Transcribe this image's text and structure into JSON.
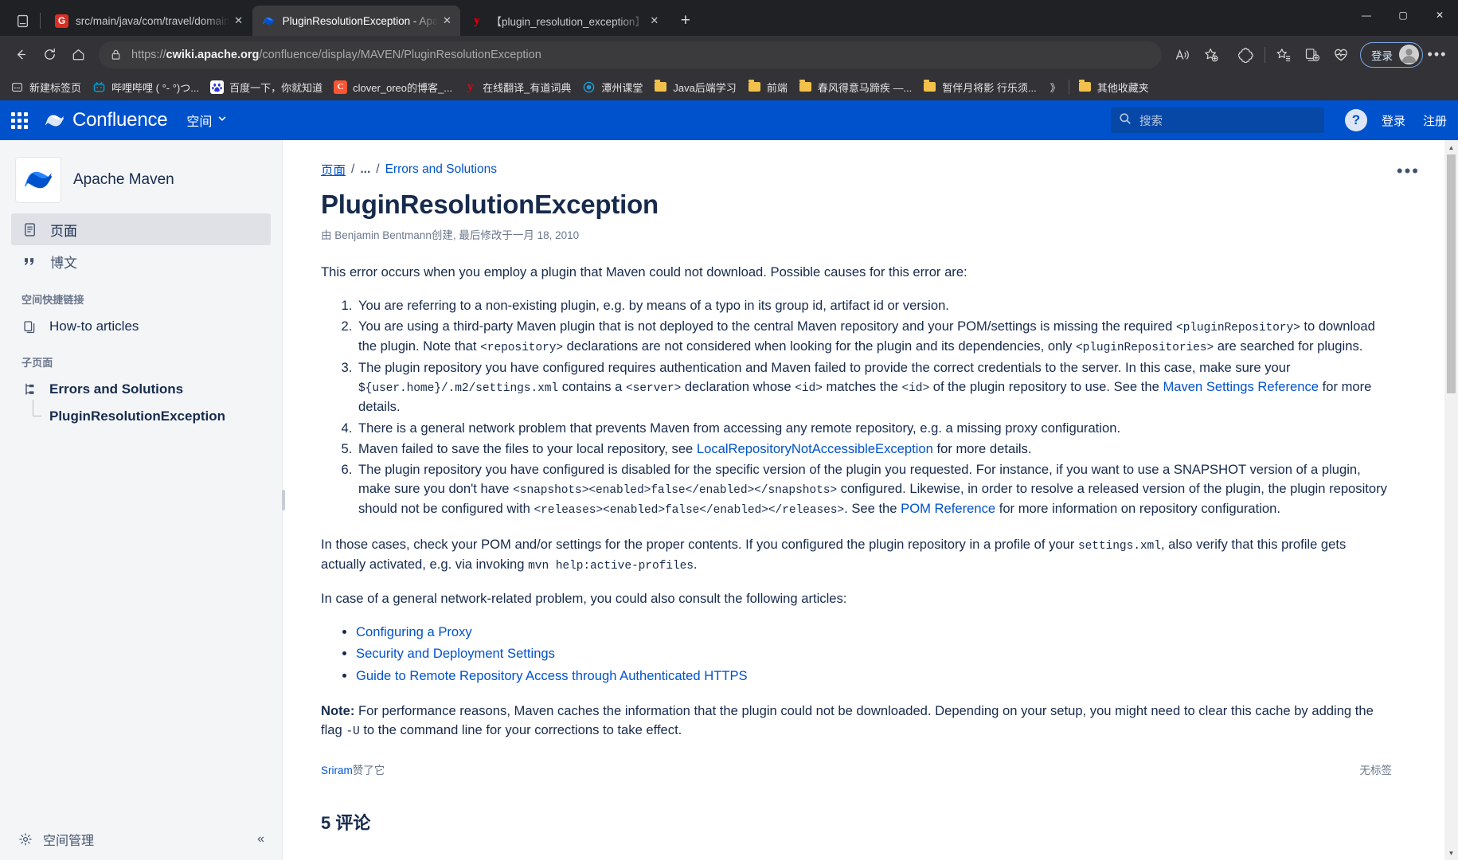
{
  "browser": {
    "tabs": [
      {
        "title": "src/main/java/com/travel/domain",
        "favicon_letter": "G",
        "favicon_color": "#d93025",
        "active": false
      },
      {
        "title": "PluginResolutionException - Apa",
        "favicon_letter": "",
        "favicon_color": "#0052CC",
        "active": true
      },
      {
        "title": "【plugin_resolution_exception】",
        "favicon_letter": "y",
        "favicon_color": "#e60012",
        "active": false
      }
    ],
    "new_tab_label": "+",
    "window_controls": {
      "minimize": "—",
      "maximize": "▢",
      "close": "✕"
    },
    "nav": {
      "back": "←",
      "refresh": "⟳",
      "home": "⌂"
    },
    "url": {
      "scheme": "https://",
      "host": "cwiki.apache.org",
      "path": "/confluence/display/MAVEN/PluginResolutionException"
    },
    "toolbar_right": {
      "signin_label": "登录"
    },
    "bookmarks": [
      {
        "label": "新建标签页",
        "icon": "newtab-icon",
        "color": "#6f7277"
      },
      {
        "label": "哔哩哔哩 ( °- °)つ...",
        "icon": "bilibili-icon",
        "color": "#00a1d6"
      },
      {
        "label": "百度一下，你就知道",
        "icon": "baidu-icon",
        "color": "#2932e1"
      },
      {
        "label": "clover_oreo的博客_...",
        "icon": "csdn-icon",
        "color": "#fc5531"
      },
      {
        "label": "在线翻译_有道词典",
        "icon": "youdao-icon",
        "color": "#e60012"
      },
      {
        "label": "潭州课堂",
        "icon": "tanzhou-icon",
        "color": "#1b9cd8"
      },
      {
        "label": "Java后端学习",
        "icon": "folder-icon",
        "color": "#f2c14b"
      },
      {
        "label": "前端",
        "icon": "folder-icon",
        "color": "#f2c14b"
      },
      {
        "label": "春风得意马蹄疾 —...",
        "icon": "folder-icon",
        "color": "#f2c14b"
      },
      {
        "label": "暂伴月将影 行乐须...",
        "icon": "folder-icon",
        "color": "#f2c14b"
      }
    ],
    "bookmarks_overflow": "》",
    "other_bookmarks": {
      "label": "其他收藏夹",
      "icon": "folder-icon"
    }
  },
  "confluence": {
    "product_name": "Confluence",
    "nav_spaces": "空间",
    "search_placeholder": "搜索",
    "help_label": "?",
    "login": "登录",
    "signup": "注册"
  },
  "sidebar": {
    "space_name": "Apache Maven",
    "items": [
      {
        "label": "页面",
        "icon": "page-icon",
        "selected": true
      },
      {
        "label": "博文",
        "icon": "quote-icon",
        "selected": false
      }
    ],
    "section_shortcuts": "空间快捷链接",
    "shortcuts": [
      {
        "label": "How-to articles",
        "icon": "copy-icon"
      }
    ],
    "section_children": "子页面",
    "children": [
      {
        "label": "Errors and Solutions",
        "icon": "pagetree-icon"
      },
      {
        "label": "PluginResolutionException",
        "icon": ""
      }
    ],
    "footer": {
      "label": "空间管理",
      "icon": "gear-icon",
      "collapse": "«"
    }
  },
  "page": {
    "breadcrumb": {
      "root": "页面",
      "sep": "/",
      "ellipsis": "...",
      "parent": "Errors and Solutions"
    },
    "title": "PluginResolutionException",
    "byline": "由 Benjamin Bentmann创建, 最后修改于一月 18, 2010",
    "more_actions": "•••",
    "intro": "This error occurs when you employ a plugin that Maven could not download. Possible causes for this error are:",
    "causes": [
      {
        "parts": [
          {
            "t": "You are referring to a non-existing plugin, e.g. by means of a typo in its group id, artifact id or version.",
            "k": "text"
          }
        ]
      },
      {
        "parts": [
          {
            "t": "You are using a third-party Maven plugin that is not deployed to the central Maven repository and your POM/settings is missing the required ",
            "k": "text"
          },
          {
            "t": "<pluginRepository>",
            "k": "code"
          },
          {
            "t": " to download the plugin. Note that ",
            "k": "text"
          },
          {
            "t": "<repository>",
            "k": "code"
          },
          {
            "t": " declarations are not considered when looking for the plugin and its dependencies, only ",
            "k": "text"
          },
          {
            "t": "<pluginRepositories>",
            "k": "code"
          },
          {
            "t": " are searched for plugins.",
            "k": "text"
          }
        ]
      },
      {
        "parts": [
          {
            "t": "The plugin repository you have configured requires authentication and Maven failed to provide the correct credentials to the server. In this case, make sure your ",
            "k": "text"
          },
          {
            "t": "${user.home}/.m2/settings.xml",
            "k": "code"
          },
          {
            "t": " contains a ",
            "k": "text"
          },
          {
            "t": "<server>",
            "k": "code"
          },
          {
            "t": " declaration whose ",
            "k": "text"
          },
          {
            "t": "<id>",
            "k": "code"
          },
          {
            "t": " matches the ",
            "k": "text"
          },
          {
            "t": "<id>",
            "k": "code"
          },
          {
            "t": " of the plugin repository to use. See the ",
            "k": "text"
          },
          {
            "t": "Maven Settings Reference",
            "k": "link"
          },
          {
            "t": " for more details.",
            "k": "text"
          }
        ]
      },
      {
        "parts": [
          {
            "t": "There is a general network problem that prevents Maven from accessing any remote repository, e.g. a missing proxy configuration.",
            "k": "text"
          }
        ]
      },
      {
        "parts": [
          {
            "t": "Maven failed to save the files to your local repository, see ",
            "k": "text"
          },
          {
            "t": "LocalRepositoryNotAccessibleException",
            "k": "link"
          },
          {
            "t": " for more details.",
            "k": "text"
          }
        ]
      },
      {
        "parts": [
          {
            "t": "The plugin repository you have configured is disabled for the specific version of the plugin you requested. For instance, if you want to use a SNAPSHOT version of a plugin, make sure you don't have ",
            "k": "text"
          },
          {
            "t": "<snapshots><enabled>false</enabled></snapshots>",
            "k": "code"
          },
          {
            "t": " configured. Likewise, in order to resolve a released version of the plugin, the plugin repository should not be configured with ",
            "k": "text"
          },
          {
            "t": "<releases><enabled>false</enabled></releases>",
            "k": "code"
          },
          {
            "t": ". See the ",
            "k": "text"
          },
          {
            "t": "POM Reference",
            "k": "link"
          },
          {
            "t": " for more information on repository configuration.",
            "k": "text"
          }
        ]
      }
    ],
    "para2": {
      "parts": [
        {
          "t": "In those cases, check your POM and/or settings for the proper contents. If you configured the plugin repository in a profile of your ",
          "k": "text"
        },
        {
          "t": "settings.xml",
          "k": "code"
        },
        {
          "t": ", also verify that this profile gets actually activated, e.g. via invoking ",
          "k": "text"
        },
        {
          "t": "mvn help:active-profiles",
          "k": "code"
        },
        {
          "t": ".",
          "k": "text"
        }
      ]
    },
    "para3": "In case of a general network-related problem, you could also consult the following articles:",
    "article_links": [
      "Configuring a Proxy",
      "Security and Deployment Settings",
      "Guide to Remote Repository Access through Authenticated HTTPS"
    ],
    "note": {
      "label": "Note:",
      "parts": [
        {
          "t": " For performance reasons, Maven caches the information that the plugin could not be downloaded. Depending on your setup, you might need to clear this cache by adding the flag ",
          "k": "text"
        },
        {
          "t": "-U",
          "k": "code"
        },
        {
          "t": " to the command line for your corrections to take effect.",
          "k": "text"
        }
      ]
    },
    "likes": {
      "user": "Sriram",
      "suffix": "赞了它"
    },
    "labels": "无标签",
    "comments_heading": "5 评论"
  },
  "colors": {
    "confluence_blue": "#0052CC",
    "link_blue": "#0052CC",
    "sidebar_bg": "#F4F5F7",
    "chrome_bg": "#333337"
  }
}
